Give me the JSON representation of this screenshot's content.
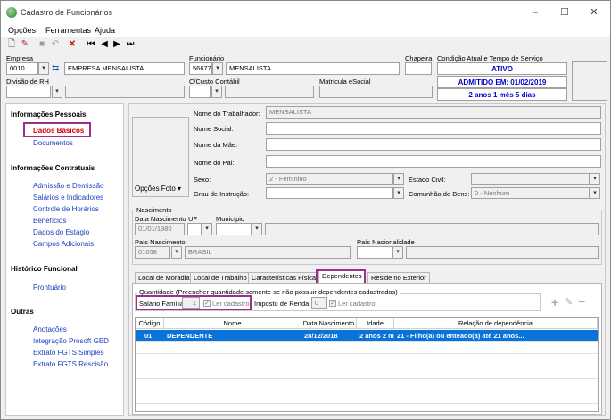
{
  "window": {
    "title": "Cadastro de Funcionários",
    "controls": {
      "minimize": "–",
      "maximize": "☐",
      "close": "✕"
    }
  },
  "menu": [
    "Opções",
    "Ferramentas",
    "Ajuda"
  ],
  "toolbar": [
    "new-icon",
    "edit-icon",
    "save-icon",
    "undo-icon",
    "delete-icon",
    "first-icon",
    "prev-icon",
    "next-icon",
    "last-icon"
  ],
  "header": {
    "empresa_label": "Empresa",
    "empresa_code": "0010",
    "empresa_name": "EMPRESA MENSALISTA",
    "funcionario_label": "Funcionário",
    "funcionario_code": "56677",
    "funcionario_name": "MENSALISTA",
    "chapeira_label": "Chapeira",
    "chapeira_value": "",
    "condicao_label": "Condição Atual e Tempo de Serviço",
    "status_ativo": "ATIVO",
    "status_admitido": "ADMITIDO EM: 01/02/2019",
    "status_tempo": "2 anos 1 mês 5 dias",
    "divisao_label": "Divisão de RH",
    "divisao_value": "",
    "ccusto_label": "C/Custo Contábil",
    "ccusto_value": "",
    "matricula_label": "Matrícula eSocial",
    "matricula_value": ""
  },
  "sidebar": {
    "sections": [
      {
        "title": "Informações Pessoais",
        "items": [
          "Dados Básicos",
          "Documentos"
        ]
      },
      {
        "title": "Informações Contratuais",
        "items": [
          "Admissão e Demissão",
          "Salários e Indicadores",
          "Controle de Horários",
          "Benefícios",
          "Dados do Estágio",
          "Campos Adicionais"
        ]
      },
      {
        "title": "Histórico Funcional",
        "items": [
          "Prontuário"
        ]
      },
      {
        "title": "Outras",
        "items": [
          "Anotações",
          "Integração Prosoft GED",
          "Extrato FGTS Simples",
          "Extrato FGTS Rescisão"
        ]
      }
    ],
    "active_item": "Dados Básicos"
  },
  "form": {
    "photo_button": "Opções Foto",
    "nome_trabalhador_label": "Nome do Trabalhador:",
    "nome_trabalhador": "MENSALISTA",
    "nome_social_label": "Nome Social:",
    "nome_social": "",
    "nome_mae_label": "Nome da Mãe:",
    "nome_mae": "",
    "nome_pai_label": "Nome do Pai:",
    "nome_pai": "",
    "sexo_label": "Sexo:",
    "sexo": "2 - Feminino",
    "estado_civil_label": "Estado Civil:",
    "estado_civil": "",
    "grau_label": "Grau de Instrução:",
    "grau": "",
    "comunhao_label": "Comunhão de Bens:",
    "comunhao": "0 - Nenhum"
  },
  "nascimento": {
    "group_label": "Nascimento",
    "data_label": "Data Nascimento",
    "data": "01/01/1980",
    "uf_label": "UF",
    "uf": "",
    "municipio_label": "Município",
    "municipio": "",
    "pais_label": "País Nascimento",
    "pais_code": "01058",
    "pais_name": "BRASIL",
    "nacionalidade_label": "País Nacionalidade",
    "nacionalidade": ""
  },
  "tabs": [
    "Local de Moradia",
    "Local de Trabalho",
    "Características Físicas",
    "Dependentes",
    "Reside no Exterior"
  ],
  "active_tab": "Dependentes",
  "dependentes": {
    "group_label": "Quantidade (Preencher quantidade somente se não possuir dependentes cadastrados)",
    "salario_familia_label": "Salário Família",
    "salario_familia_value": "1",
    "ler_cadastro_1": "Ler cadastro",
    "imposto_renda_label": "Imposto de Renda",
    "imposto_renda_value": "0",
    "ler_cadastro_2": "Ler cadastro",
    "columns": [
      "Código",
      "Nome",
      "Data Nascimento",
      "Idade",
      "Relação de dependência"
    ],
    "rows": [
      [
        "01",
        "DEPENDENTE",
        "28/12/2018",
        "2 anos 2 m",
        "21 - Filho(a) ou enteado(a) até 21 anos..."
      ]
    ]
  },
  "colors": {
    "link": "#1a3fbf",
    "active_link": "#cc0000",
    "highlight": "#9b2f8f",
    "selection": "#0a73d9",
    "status_text": "#0000cc"
  }
}
